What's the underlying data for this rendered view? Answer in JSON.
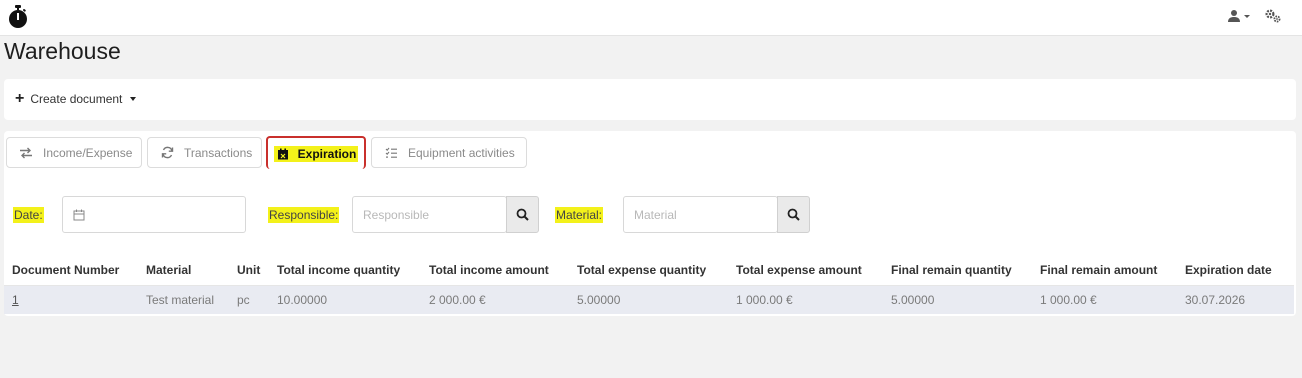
{
  "header": {
    "logo_icon": "stopwatch-icon",
    "user_icon": "user-icon",
    "settings_icon": "gears-icon"
  },
  "page": {
    "title": "Warehouse"
  },
  "toolbar": {
    "create_label": "Create document"
  },
  "tabs": [
    {
      "label": "Income/Expense",
      "icon": "arrows-exchange-icon",
      "active": false
    },
    {
      "label": "Transactions",
      "icon": "refresh-icon",
      "active": false
    },
    {
      "label": "Expiration",
      "icon": "calendar-x-icon",
      "active": true
    },
    {
      "label": "Equipment activities",
      "icon": "checklist-icon",
      "active": false
    }
  ],
  "filters": {
    "date_label": "Date:",
    "date_value": "",
    "responsible_label": "Responsible:",
    "responsible_placeholder": "Responsible",
    "material_label": "Material:",
    "material_placeholder": "Material"
  },
  "highlight_color": "#f3f11a",
  "active_tab_border": "#c9302c",
  "table": {
    "columns": [
      "Document Number",
      "Material",
      "Unit",
      "Total income quantity",
      "Total income amount",
      "Total expense quantity",
      "Total expense amount",
      "Final remain quantity",
      "Final remain amount",
      "Expiration date"
    ],
    "rows": [
      [
        "1",
        "Test material",
        "pc",
        "10.00000",
        "2 000.00 €",
        "5.00000",
        "1 000.00 €",
        "5.00000",
        "1 000.00 €",
        "30.07.2026"
      ]
    ]
  }
}
